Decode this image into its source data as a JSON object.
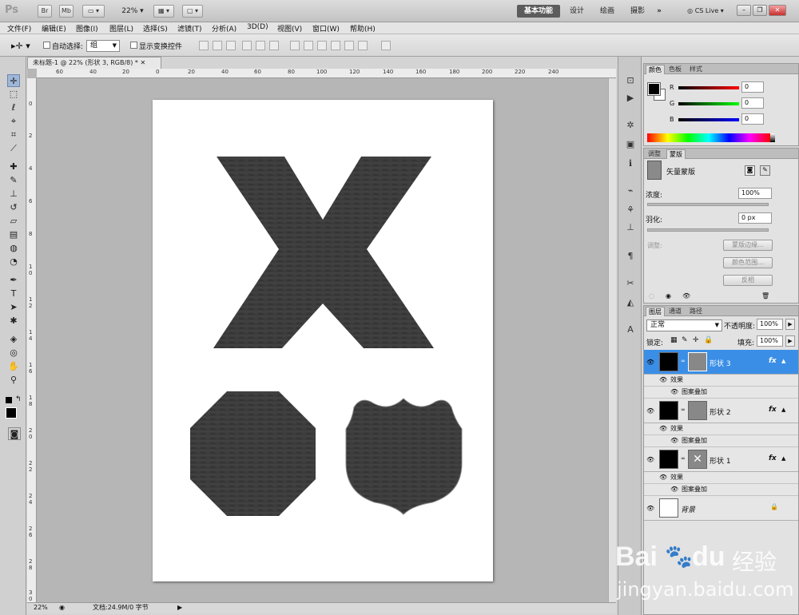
{
  "app": {
    "logo": "Ps",
    "bridge": "Br",
    "mini_bridge": "Mb",
    "zoom": "22%",
    "workspaces": [
      "基本功能",
      "设计",
      "绘画",
      "摄影"
    ],
    "more": "»",
    "cs_live": "CS Live"
  },
  "menu": [
    "文件(F)",
    "编辑(E)",
    "图像(I)",
    "图层(L)",
    "选择(S)",
    "滤镜(T)",
    "分析(A)",
    "3D(D)",
    "视图(V)",
    "窗口(W)",
    "帮助(H)"
  ],
  "options": {
    "auto_select_label": "自动选择:",
    "auto_select_value": "组",
    "show_transform_label": "显示变换控件"
  },
  "document": {
    "tab_title": "未标题-1 @ 22% (形状 3, RGB/8) *",
    "ruler_top": [
      "60",
      "40",
      "20",
      "0",
      "20",
      "40",
      "60",
      "80",
      "100",
      "120",
      "140",
      "160",
      "180",
      "200",
      "220",
      "240"
    ],
    "ruler_left": [
      "0",
      "2",
      "4",
      "6",
      "8",
      "1 0",
      "1 2",
      "1 4",
      "1 6",
      "1 8",
      "2 0",
      "2 2",
      "2 4",
      "2 6",
      "2 8",
      "3 0"
    ],
    "status_zoom": "22%",
    "status_doc": "文档:24.9M/0 字节"
  },
  "color_panel": {
    "tabs": [
      "颜色",
      "色板",
      "样式"
    ],
    "channels": [
      {
        "name": "R",
        "value": "0",
        "color": "#d42020"
      },
      {
        "name": "G",
        "value": "0",
        "color": "#20b020"
      },
      {
        "name": "B",
        "value": "0",
        "color": "#2030d0"
      }
    ]
  },
  "mask_panel": {
    "tabs": [
      "调整",
      "蒙版"
    ],
    "vector_mask": "矢量蒙版",
    "density_label": "浓度:",
    "density_value": "100%",
    "feather_label": "羽化:",
    "feather_value": "0 px",
    "refine_label": "调整:",
    "buttons": [
      "蒙版边缘...",
      "颜色范围...",
      "反相"
    ]
  },
  "layers_panel": {
    "tabs": [
      "图层",
      "通道",
      "路径"
    ],
    "blend_mode": "正常",
    "opacity_label": "不透明度:",
    "opacity_value": "100%",
    "lock_label": "锁定:",
    "fill_label": "填充:",
    "fill_value": "100%",
    "effects_label": "效果",
    "pattern_overlay": "图案叠加",
    "fx": "fx",
    "layers": [
      {
        "name": "形状 3",
        "selected": true
      },
      {
        "name": "形状 2",
        "selected": false
      },
      {
        "name": "形状 1",
        "selected": false
      }
    ],
    "background": "背景"
  },
  "watermark": {
    "brand": "Bai",
    "brand2": "du",
    "suffix": "经验",
    "url": "jingyan.baidu.com"
  }
}
